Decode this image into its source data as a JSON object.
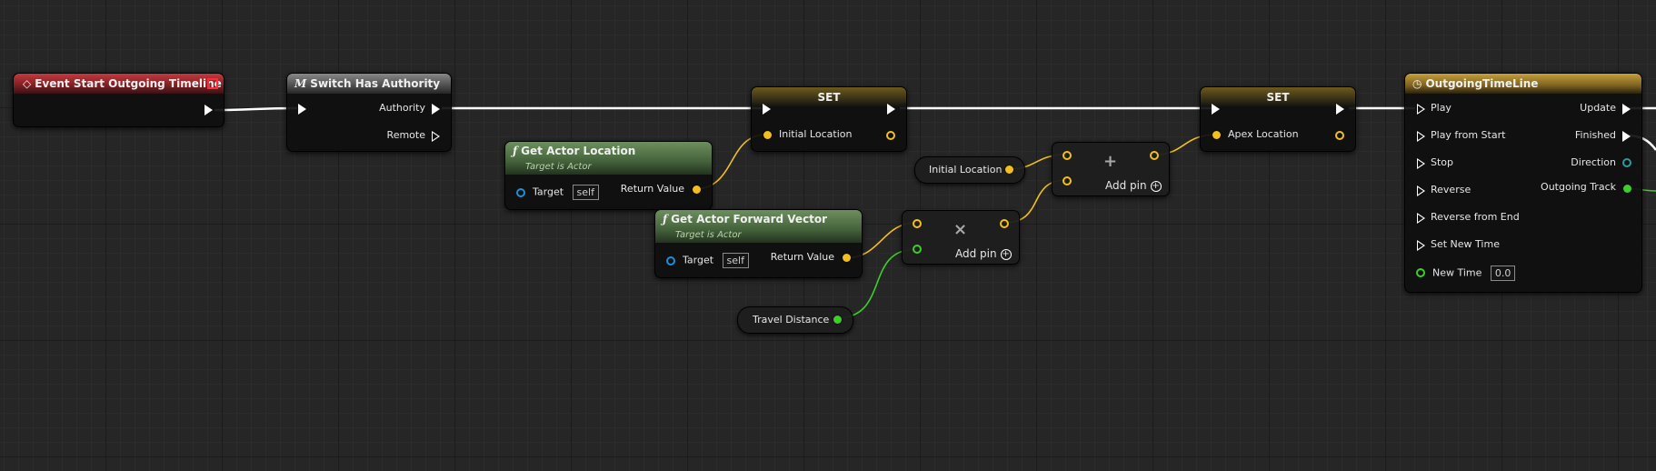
{
  "nodes": {
    "event_start": {
      "title": "Event Start Outgoing Timeline"
    },
    "switch_authority": {
      "title": "Switch Has Authority",
      "pin_authority": "Authority",
      "pin_remote": "Remote"
    },
    "set1": {
      "title": "SET",
      "pin_var": "Initial Location"
    },
    "set2": {
      "title": "SET",
      "pin_var": "Apex Location"
    },
    "get_actor_location": {
      "title": "Get Actor Location",
      "subtitle": "Target is Actor",
      "target_label": "Target",
      "target_value": "self",
      "return_label": "Return Value"
    },
    "get_forward_vector": {
      "title": "Get Actor Forward Vector",
      "subtitle": "Target is Actor",
      "target_label": "Target",
      "target_value": "self",
      "return_label": "Return Value"
    },
    "initial_location_var": {
      "label": "Initial Location"
    },
    "travel_distance_var": {
      "label": "Travel Distance"
    },
    "add_node": {
      "symbol": "+",
      "add_pin": "Add pin"
    },
    "multiply_node": {
      "symbol": "×",
      "add_pin": "Add pin"
    },
    "timeline": {
      "title": "OutgoingTimeLine",
      "inputs": [
        "Play",
        "Play from Start",
        "Stop",
        "Reverse",
        "Reverse from End",
        "Set New Time"
      ],
      "new_time_label": "New Time",
      "new_time_value": "0.0",
      "outputs": [
        "Update",
        "Finished",
        "Direction",
        "Outgoing Track"
      ]
    }
  },
  "colors": {
    "exec_wire": "#ffffff",
    "vector_wire": "#f2c01c",
    "float_wire": "#3ccf26",
    "event_header": "#b3353a",
    "function_header": "#5a7a4c",
    "timeline_header": "#b8922f"
  },
  "icons": {
    "event": "event-diamond-icon",
    "macro": "macro-m-icon",
    "function": "function-f-icon",
    "timeline": "clock-icon"
  }
}
